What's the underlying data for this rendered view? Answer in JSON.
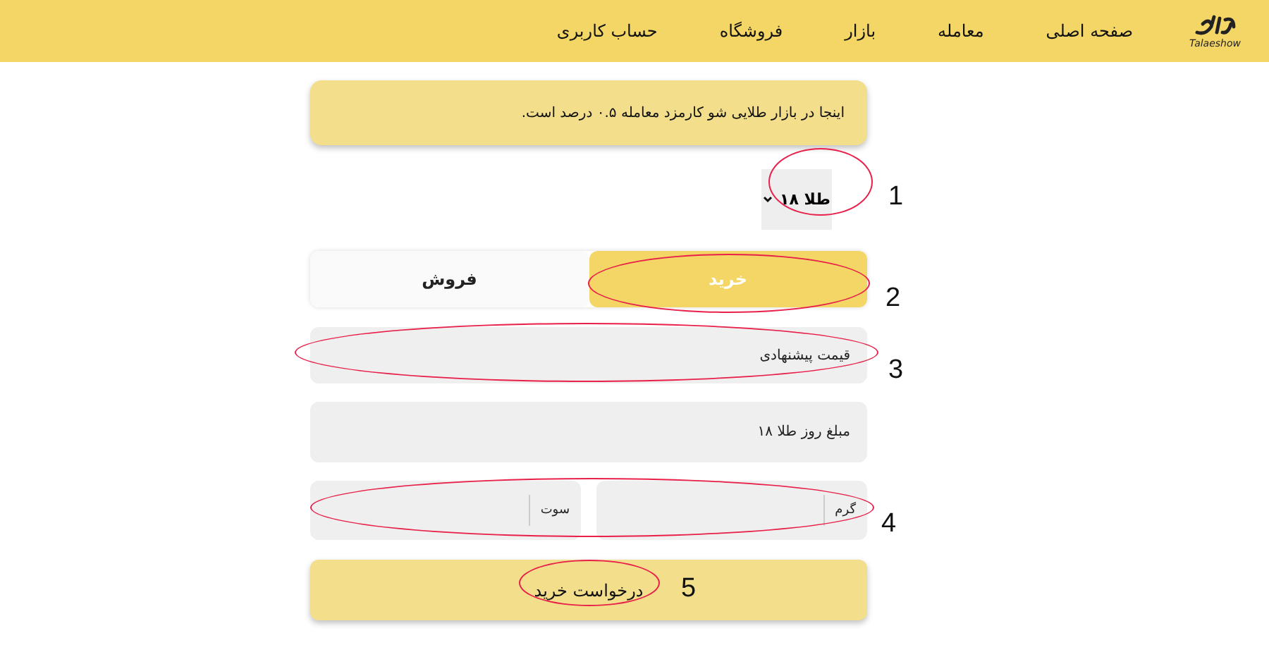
{
  "nav": {
    "logo_caption": "Talaeshow",
    "items": [
      {
        "label": "صفحه اصلی"
      },
      {
        "label": "معامله"
      },
      {
        "label": "بازار"
      },
      {
        "label": "فروشگاه"
      },
      {
        "label": "حساب کاربری"
      }
    ]
  },
  "notice": "اینجا در بازار طلایی شو کارمزد معامله ۰.۵ درصد است.",
  "asset_select": {
    "value": "طلا ۱۸",
    "annotation": "1"
  },
  "tabs": {
    "annotation": "2",
    "items": [
      {
        "label": "خرید",
        "selected": true
      },
      {
        "label": "فروش",
        "selected": false
      }
    ]
  },
  "price_field": {
    "placeholder": "قیمت پیشنهادی",
    "annotation": "3"
  },
  "rate_field": {
    "placeholder": "مبلغ روز طلا ۱۸"
  },
  "amount_fields": {
    "annotation": "4",
    "items": [
      {
        "unit": "گرم"
      },
      {
        "unit": "سوت"
      }
    ]
  },
  "submit": {
    "label": "درخواست خرید",
    "annotation": "5"
  }
}
